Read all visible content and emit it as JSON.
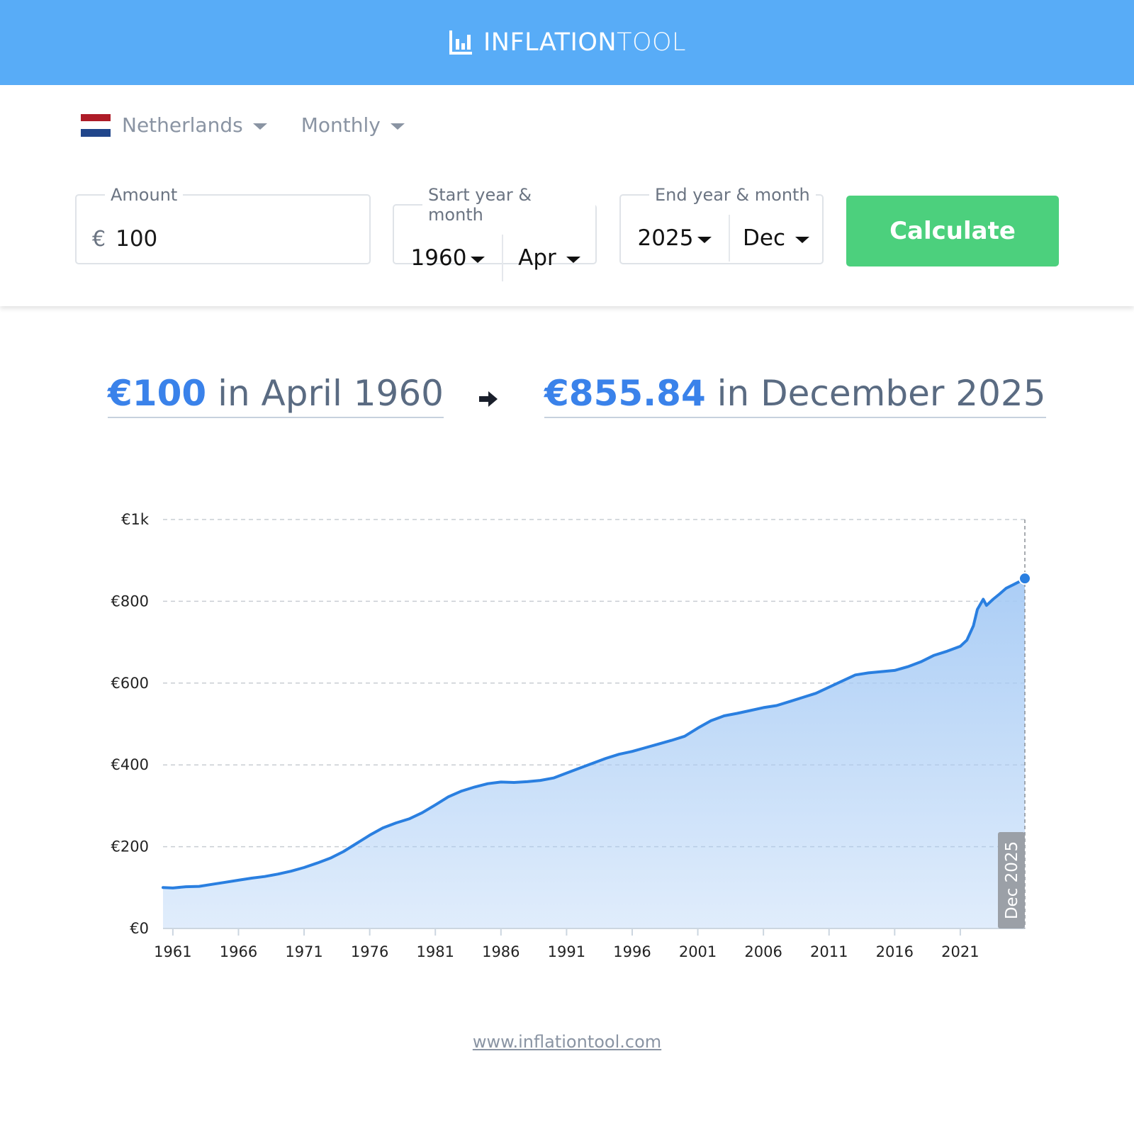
{
  "header": {
    "logo_bold": "INFLATION",
    "logo_light": "TOOL",
    "logo_icon": "bar-chart-icon",
    "background": "#58acf7"
  },
  "selectors": {
    "country": "Netherlands",
    "period": "Monthly",
    "flag_colors": [
      "#ae1c28",
      "#ffffff",
      "#21468b"
    ]
  },
  "form": {
    "amount_label": "Amount",
    "currency_symbol": "€",
    "amount_value": "100",
    "start_label": "Start year & month",
    "start_year": "1960",
    "start_month": "Apr",
    "end_label": "End year & month",
    "end_year": "2025",
    "end_month": "Dec",
    "calculate_label": "Calculate",
    "calculate_color": "#4cd07d"
  },
  "result": {
    "from_amount": "€100",
    "from_text": "in April 1960",
    "to_amount": "€855.84",
    "to_text": "in December 2025",
    "accent": "#3a82ea"
  },
  "chart_data": {
    "type": "area",
    "y_ticks": [
      "€0",
      "€200",
      "€400",
      "€600",
      "€800",
      "€1k"
    ],
    "ylim": [
      0,
      1000
    ],
    "x_ticks": [
      "1961",
      "1966",
      "1971",
      "1976",
      "1981",
      "1986",
      "1991",
      "1996",
      "2001",
      "2006",
      "2011",
      "2016",
      "2021"
    ],
    "xlim": [
      1960.25,
      2025.92
    ],
    "grid": true,
    "line_color": "#2a7fe0",
    "fill_color": "#a7cbf5",
    "series": [
      {
        "x": [
          1960.25,
          1961,
          1962,
          1963,
          1964,
          1965,
          1966,
          1967,
          1968,
          1969,
          1970,
          1971,
          1972,
          1973,
          1974,
          1975,
          1976,
          1977,
          1978,
          1979,
          1980,
          1981,
          1982,
          1983,
          1984,
          1985,
          1986,
          1987,
          1988,
          1989,
          1990,
          1991,
          1992,
          1993,
          1994,
          1995,
          1996,
          1997,
          1998,
          1999,
          2000,
          2001,
          2002,
          2003,
          2004,
          2005,
          2006,
          2007,
          2008,
          2009,
          2010,
          2011,
          2012,
          2013,
          2014,
          2015,
          2016,
          2017,
          2018,
          2019,
          2020,
          2021,
          2021.5,
          2022,
          2022.3,
          2022.75,
          2023,
          2023.5,
          2024,
          2024.5,
          2025,
          2025.5,
          2025.92
        ],
        "y": [
          100,
          99,
          102,
          103,
          108,
          113,
          118,
          123,
          127,
          133,
          140,
          149,
          160,
          172,
          188,
          208,
          228,
          246,
          258,
          268,
          283,
          302,
          322,
          336,
          346,
          354,
          358,
          357,
          359,
          362,
          368,
          380,
          392,
          404,
          416,
          426,
          433,
          442,
          451,
          460,
          470,
          490,
          508,
          520,
          526,
          533,
          540,
          545,
          555,
          565,
          575,
          590,
          605,
          620,
          625,
          628,
          631,
          640,
          652,
          668,
          678,
          690,
          705,
          740,
          780,
          805,
          790,
          805,
          818,
          832,
          840,
          848,
          855.84
        ]
      }
    ],
    "end_point_label": "Dec 2025"
  },
  "footer": {
    "link_text": "www.inflationtool.com"
  }
}
